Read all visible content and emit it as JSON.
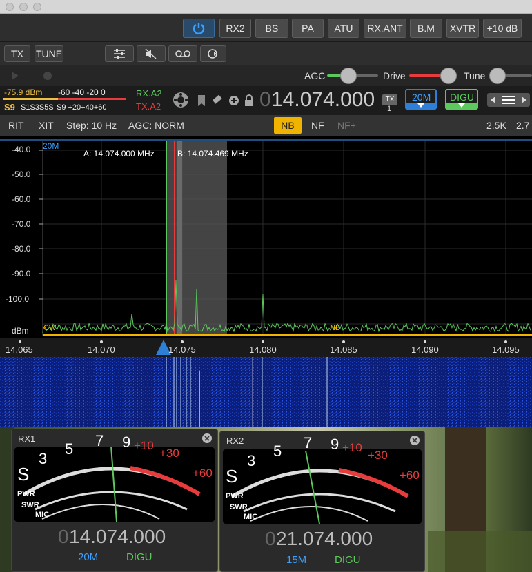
{
  "toolbar": {
    "rx2": "RX2",
    "bs": "BS",
    "pa": "PA",
    "atu": "ATU",
    "rxant": "RX.ANT",
    "bm": "B.M",
    "xvtr": "XVTR",
    "gain": "+10 dB"
  },
  "row2": {
    "tx": "TX",
    "tune": "TUNE"
  },
  "row3": {
    "agc": "AGC",
    "drive": "Drive",
    "tune": "Tune"
  },
  "vfo": {
    "dbm": "-75.9 dBm",
    "s9": "S9",
    "scale_top": "-60 -40 -20  0",
    "scale_s": "S1S3S5S",
    "scale_s9": "S9 +20+40+60",
    "rx": "RX.A2",
    "tx": "TX.A2",
    "freq_lead": "0",
    "freq": "14.074.000",
    "tx_badge": "TX",
    "tx_num": "1",
    "band": "20M",
    "mode": "DIGU"
  },
  "row5": {
    "rit": "RIT",
    "xit": "XIT",
    "step": "Step: 10 Hz",
    "agc": "AGC: NORM",
    "nb": "NB",
    "nf": "NF",
    "nfplus": "NF+",
    "bw1": "2.5K",
    "bw2": "2.7"
  },
  "pan": {
    "band": "20M",
    "marker_a": "A: 14.074.000 MHz",
    "marker_b": "B: 14.074.469 MHz",
    "db_labels": [
      "-40.0",
      "-50.0",
      "-60.0",
      "-70.0",
      "-80.0",
      "-90.0",
      "-100.0"
    ],
    "unit": "dBm",
    "cw": "CW",
    "nb": "NB",
    "freq_labels": [
      "14.065",
      "14.070",
      "14.075",
      "14.080",
      "14.085",
      "14.090",
      "14.095"
    ]
  },
  "meter_scale": {
    "s_nums": [
      "S",
      "3",
      "5",
      "7",
      "9"
    ],
    "plus": [
      "+10",
      "+30",
      "+60"
    ],
    "pwr": "PWR",
    "swr": "SWR",
    "mic": "MIC"
  },
  "rx1": {
    "title": "RX1",
    "freq_lead": "0",
    "freq": "14.074.000",
    "band": "20M",
    "mode": "DIGU"
  },
  "rx2": {
    "title": "RX2",
    "freq_lead": "0",
    "freq": "21.074.000",
    "band": "15M",
    "mode": "DIGU"
  },
  "colors": {
    "accent": "#2d7fd8",
    "green": "#5dc85d",
    "red": "#e83c3c",
    "amber": "#f0b400"
  }
}
